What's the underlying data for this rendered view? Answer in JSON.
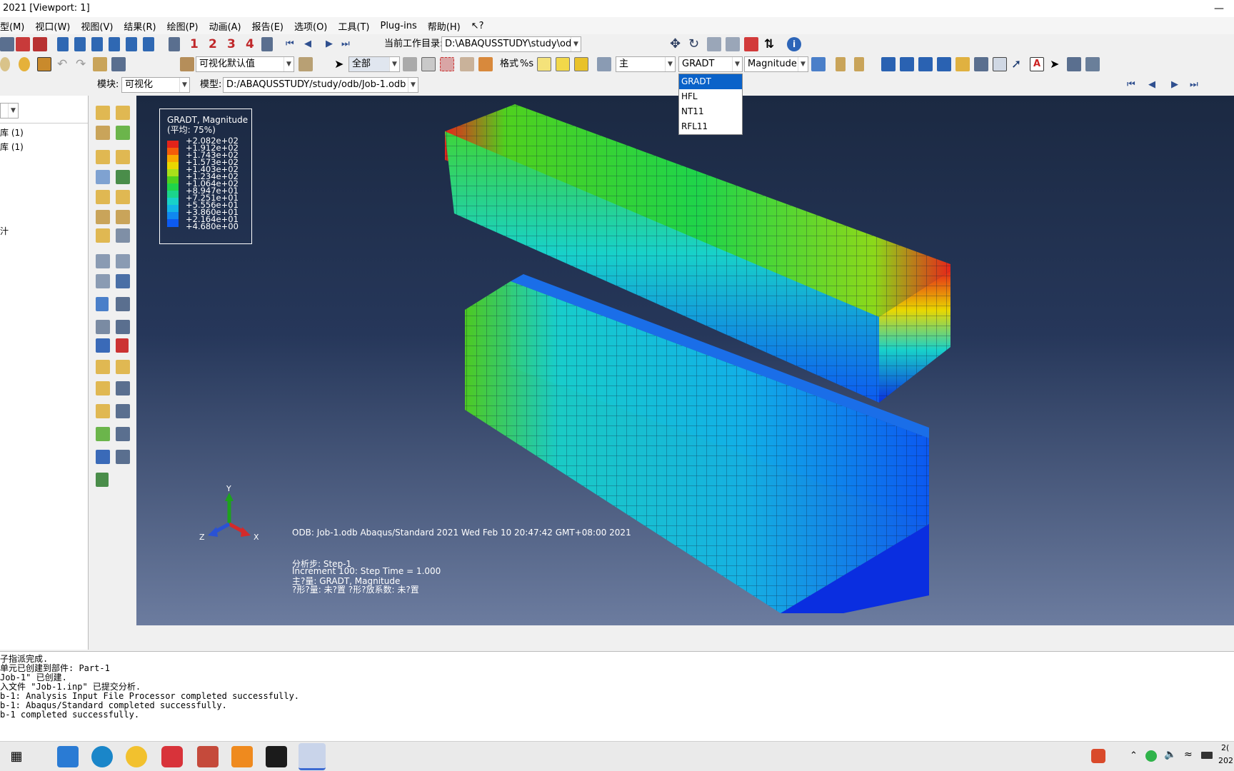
{
  "window": {
    "title": "2021 [Viewport: 1]"
  },
  "menu": [
    "型(M)",
    "视口(W)",
    "视图(V)",
    "结果(R)",
    "绘图(P)",
    "动画(A)",
    "报告(E)",
    "选项(O)",
    "工具(T)",
    "Plug-ins",
    "帮助(H)",
    "↖?"
  ],
  "toolbar1": {
    "frame_numbers": [
      "1",
      "2",
      "3",
      "4"
    ],
    "workdir_label": "当前工作目录:",
    "workdir_value": "D:\\ABAQUSSTUDY\\study\\odb"
  },
  "toolbar2": {
    "vis_defaults": "可视化默认值",
    "selection": "全部",
    "format_label": "格式",
    "format_value": "%s",
    "primary": "主",
    "variable": "GRADT",
    "invariant": "Magnitude"
  },
  "variable_dropdown": {
    "options": [
      "GRADT",
      "HFL",
      "NT11",
      "RFL11"
    ],
    "selected": "GRADT"
  },
  "toolbar3": {
    "module_label": "模块:",
    "module_value": "可视化",
    "model_label": "模型:",
    "model_value": "D:/ABAQUSSTUDY/study/odb/Job-1.odb"
  },
  "tree": {
    "items": [
      "库 (1)",
      "库 (1)",
      "汁"
    ]
  },
  "legend": {
    "title": "GRADT, Magnitude",
    "subtitle": "(平均: 75%)",
    "values": [
      "+2.082e+02",
      "+1.912e+02",
      "+1.743e+02",
      "+1.573e+02",
      "+1.403e+02",
      "+1.234e+02",
      "+1.064e+02",
      "+8.947e+01",
      "+7.251e+01",
      "+5.556e+01",
      "+3.860e+01",
      "+2.164e+01",
      "+4.680e+00"
    ],
    "colors": [
      "#e2231a",
      "#f25c0a",
      "#f7a800",
      "#e9d700",
      "#a8e01a",
      "#4fd11f",
      "#1fd44a",
      "#1bd58c",
      "#18d1c9",
      "#12b4e6",
      "#1088f0",
      "#0c5af1",
      "#0a2ee0"
    ]
  },
  "info": {
    "odb_line": "ODB: Job-1.odb    Abaqus/Standard 2021    Wed Feb 10 20:47:42 GMT+08:00 2021",
    "step_line": "分析步: Step-1",
    "increment_line": "Increment    100: Step Time =    1.000",
    "primary_line": "主?量: GRADT, Magnitude",
    "deform_line": "?形?量: 未?置    ?形?放系数: 未?置"
  },
  "triad": {
    "x": "X",
    "y": "Y",
    "z": "Z"
  },
  "console": [
    "子指派完成.",
    "单元已创建到部件: Part-1",
    "Job-1\" 已创建.",
    "入文件 \"Job-1.inp\" 已提交分析.",
    "b-1: Analysis Input File Processor completed successfully.",
    "b-1: Abaqus/Standard completed successfully.",
    "b-1 completed successfully."
  ],
  "taskbar": {
    "clock_top": "2(",
    "clock_bottom": "202"
  }
}
